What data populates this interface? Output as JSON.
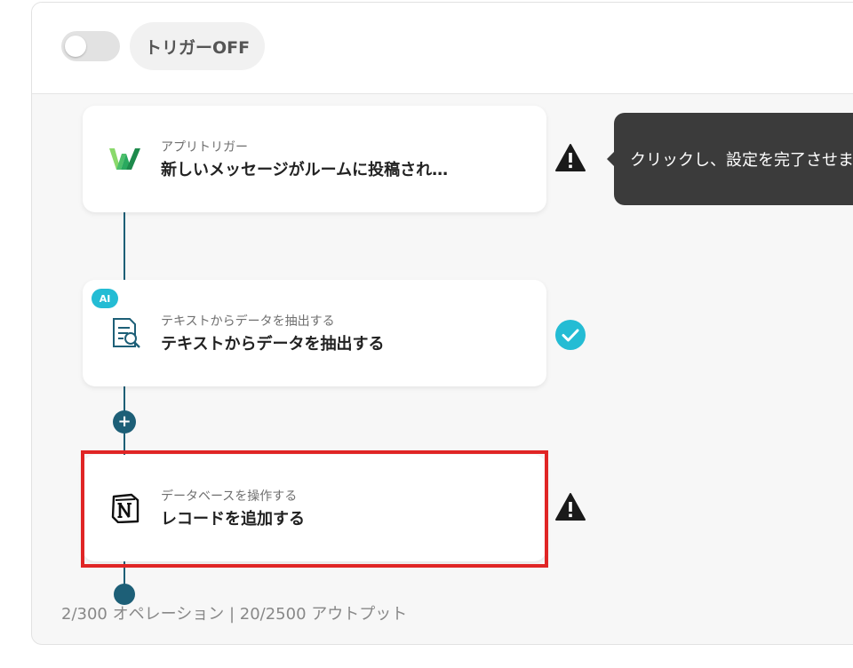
{
  "header": {
    "trigger_toggle_state": "off",
    "trigger_label": "トリガーOFF"
  },
  "steps": [
    {
      "subtitle": "アプリトリガー",
      "title": "新しいメッセージがルームに投稿され…",
      "icon": "chatwork-logo-icon",
      "status": "warning"
    },
    {
      "badge": "AI",
      "subtitle": "テキストからデータを抽出する",
      "title": "テキストからデータを抽出する",
      "icon": "document-search-icon",
      "status": "complete"
    },
    {
      "subtitle": "データベースを操作する",
      "title": "レコードを追加する",
      "icon": "notion-logo-icon",
      "status": "warning",
      "highlighted": true
    }
  ],
  "add_step_label": "+",
  "tooltip": {
    "text": "クリックし、設定を完了させま"
  },
  "footer": {
    "usage": "2/300 オペレーション | 20/2500 アウトプット"
  },
  "colors": {
    "accent": "#1d5f77",
    "success": "#24bcd4",
    "highlight": "#e02525",
    "warning": "#1a1a1a"
  }
}
